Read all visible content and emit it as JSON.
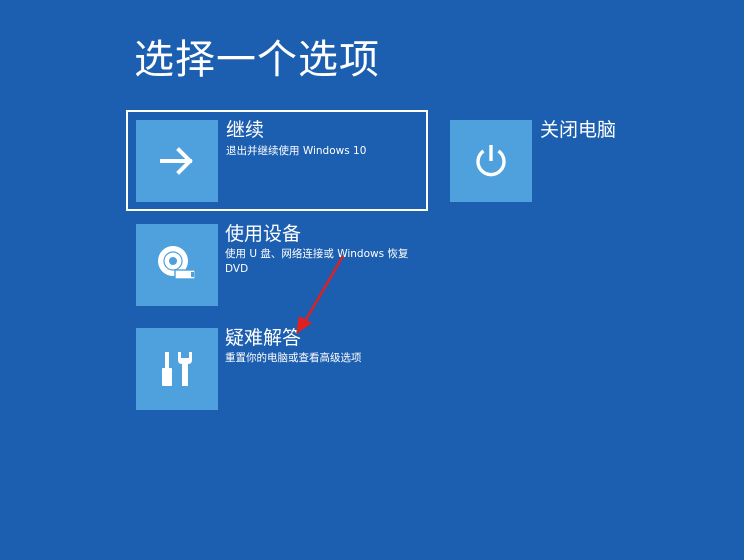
{
  "screen": {
    "title": "选择一个选项"
  },
  "options": {
    "continue": {
      "title": "继续",
      "description": "退出并继续使用 Windows 10",
      "icon": "arrow-right-icon",
      "selected": true
    },
    "shutdown": {
      "title": "关闭电脑",
      "icon": "power-icon"
    },
    "use_device": {
      "title": "使用设备",
      "description": "使用 U 盘、网络连接或 Windows 恢复 DVD",
      "icon": "disc-drive-icon"
    },
    "troubleshoot": {
      "title": "疑难解答",
      "description": "重置你的电脑或查看高级选项",
      "icon": "tools-icon"
    }
  },
  "annotation": {
    "type": "red-arrow",
    "color": "#e02020",
    "points_to": "troubleshoot"
  },
  "colors": {
    "background": "#1c5eaf",
    "tile": "#4ea1dd",
    "text": "#ffffff"
  }
}
